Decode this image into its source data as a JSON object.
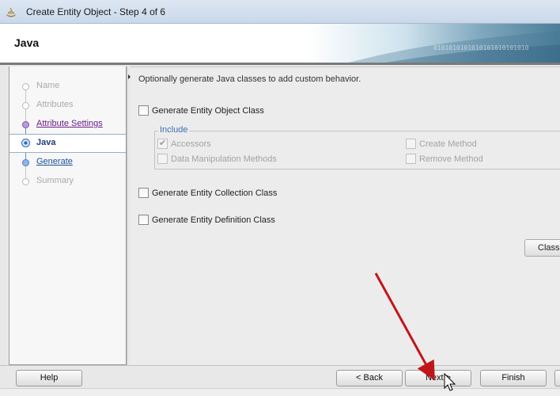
{
  "window": {
    "title": "Create Entity Object - Step 4 of 6",
    "app_icon": "oracle-jdeveloper-icon"
  },
  "header": {
    "page_title": "Java",
    "decor_text": "0101010101010101010101010"
  },
  "nav": {
    "items": [
      {
        "label": "Name",
        "state": "disabled"
      },
      {
        "label": "Attributes",
        "state": "disabled"
      },
      {
        "label": "Attribute Settings",
        "state": "visited"
      },
      {
        "label": "Java",
        "state": "active"
      },
      {
        "label": "Generate",
        "state": "link"
      },
      {
        "label": "Summary",
        "state": "disabled"
      }
    ]
  },
  "content": {
    "intro": "Optionally generate Java classes to add custom behavior.",
    "generate_entity_object_class": "Generate Entity Object Class",
    "include_group": {
      "title": "Include",
      "accessors": "Accessors",
      "create_method": "Create Method",
      "data_manipulation_methods": "Data Manipulation Methods",
      "remove_method": "Remove Method"
    },
    "generate_entity_collection_class": "Generate Entity Collection Class",
    "generate_entity_definition_class": "Generate Entity Definition Class",
    "classes_button": "Classes Extend..."
  },
  "footer": {
    "help": "Help",
    "back": "< Back",
    "next": "Next >",
    "finish": "Finish"
  },
  "colors": {
    "link": "#1d4fa0",
    "visited_link": "#6a1d88",
    "annotation_arrow": "#c0161a"
  }
}
